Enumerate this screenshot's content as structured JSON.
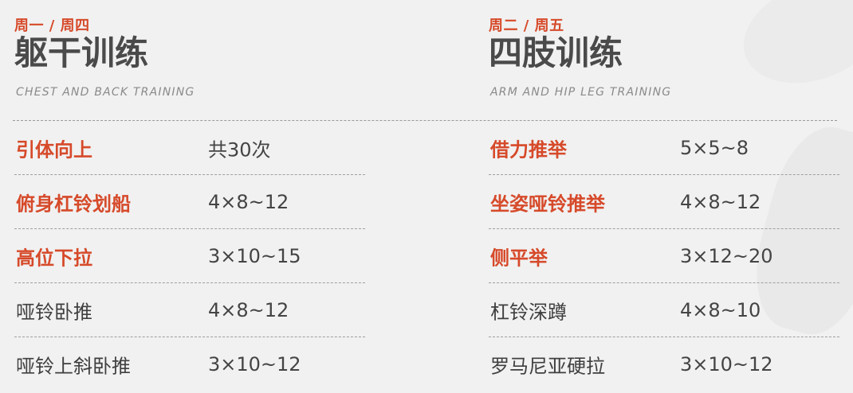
{
  "left": {
    "days": "周一 / 周四",
    "title": "躯干训练",
    "subtitle": "CHEST AND BACK TRAINING",
    "exercises": [
      {
        "name": "引体向上",
        "reps": "共30次",
        "highlight": true
      },
      {
        "name": "俯身杠铃划船",
        "reps": "4×8~12",
        "highlight": true
      },
      {
        "name": "高位下拉",
        "reps": "3×10~15",
        "highlight": true
      },
      {
        "name": "哑铃卧推",
        "reps": "4×8~12",
        "highlight": false
      },
      {
        "name": "哑铃上斜卧推",
        "reps": "3×10~12",
        "highlight": false
      }
    ]
  },
  "right": {
    "days": "周二 / 周五",
    "title": "四肢训练",
    "subtitle": "ARM AND HIP LEG TRAINING",
    "exercises": [
      {
        "name": "借力推举",
        "reps": "5×5~8",
        "highlight": true
      },
      {
        "name": "坐姿哑铃推举",
        "reps": "4×8~12",
        "highlight": true
      },
      {
        "name": "侧平举",
        "reps": "3×12~20",
        "highlight": true
      },
      {
        "name": "杠铃深蹲",
        "reps": "4×8~10",
        "highlight": false
      },
      {
        "name": "罗马尼亚硬拉",
        "reps": "3×10~12",
        "highlight": false
      }
    ]
  },
  "colors": {
    "accent": "#d64a2a",
    "title": "#4a4a4a",
    "subtitle": "#8a8a8a",
    "text": "#3f3f3f",
    "background": "#f1f1f1"
  }
}
